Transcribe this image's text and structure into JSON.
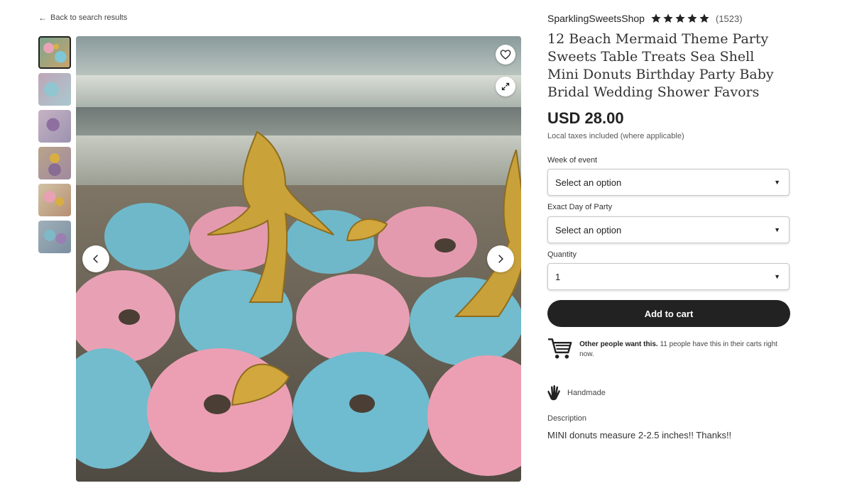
{
  "nav": {
    "back_label": "Back to search results"
  },
  "gallery": {
    "thumbnail_count": 6,
    "active_thumbnail": 1
  },
  "shop": {
    "name": "SparklingSweetsShop",
    "rating": 5,
    "review_count": "(1523)"
  },
  "listing": {
    "title": "12 Beach Mermaid Theme Party Sweets Table Treats Sea Shell Mini Donuts Birthday Party Baby Bridal Wedding Shower Favors",
    "price": "USD 28.00",
    "tax_note": "Local taxes included (where applicable)"
  },
  "options": {
    "week_label": "Week of event",
    "week_value": "Select an option",
    "day_label": "Exact Day of Party",
    "day_value": "Select an option",
    "quantity_label": "Quantity",
    "quantity_value": "1"
  },
  "cart": {
    "button_label": "Add to cart"
  },
  "demand": {
    "bold_text": "Other people want this.",
    "rest_text": " 11 people have this in their carts right now."
  },
  "handmade": {
    "label": "Handmade"
  },
  "description": {
    "label": "Description",
    "text": "MINI donuts measure 2-2.5 inches!! Thanks!!"
  },
  "icons": {
    "back": "arrow-left-icon",
    "favorite": "heart-icon",
    "expand": "expand-icon",
    "prev": "chevron-left-icon",
    "next": "chevron-right-icon",
    "star": "star-icon",
    "caret": "caret-down-icon",
    "cart": "shopping-cart-icon",
    "hand": "hand-icon"
  },
  "colors": {
    "button_bg": "#222222",
    "text": "#222222",
    "muted": "#595959"
  }
}
